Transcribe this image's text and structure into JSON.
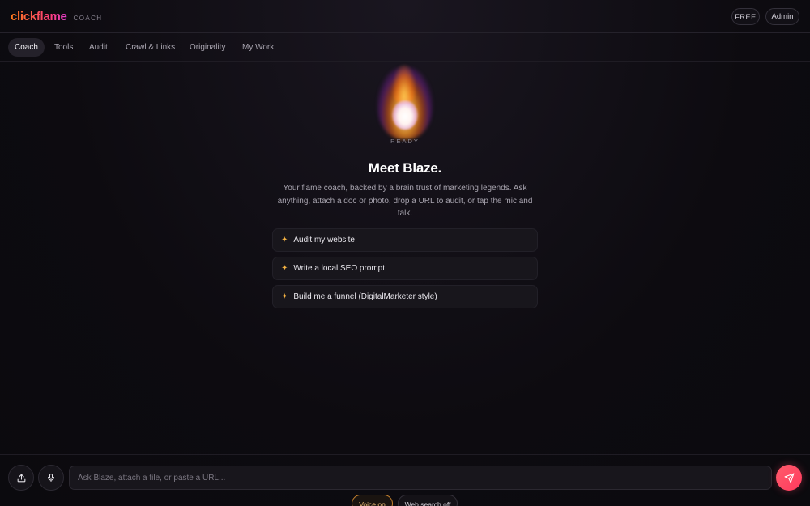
{
  "brand": {
    "name": "clickflame",
    "tag": "COACH"
  },
  "header": {
    "plan_badge": "FREE",
    "user_button": "Admin"
  },
  "nav": {
    "tabs": [
      {
        "label": "Coach",
        "active": true
      },
      {
        "label": "Tools"
      },
      {
        "label": "Audit"
      },
      {
        "label": "Crawl & Links"
      },
      {
        "label": "Originality"
      },
      {
        "label": "My Work"
      }
    ]
  },
  "avatar": {
    "status": "READY"
  },
  "hero": {
    "title": "Meet Blaze.",
    "subtitle": "Your flame coach, backed by a brain trust of marketing legends. Ask anything, attach a doc or photo, drop a URL to audit, or tap the mic and talk."
  },
  "suggestions": [
    {
      "label": "Audit my website"
    },
    {
      "label": "Write a local SEO prompt"
    },
    {
      "label": "Build me a funnel (DigitalMarketer style)"
    }
  ],
  "composer": {
    "placeholder": "Ask Blaze, attach a file, or paste a URL...",
    "voice_toggle": "Voice on",
    "web_toggle": "Web search off"
  },
  "colors": {
    "accent": "#ff3d6a",
    "brand_start": "#ff7a1a",
    "spark": "#f5b342",
    "voice_border": "#c9842e"
  }
}
